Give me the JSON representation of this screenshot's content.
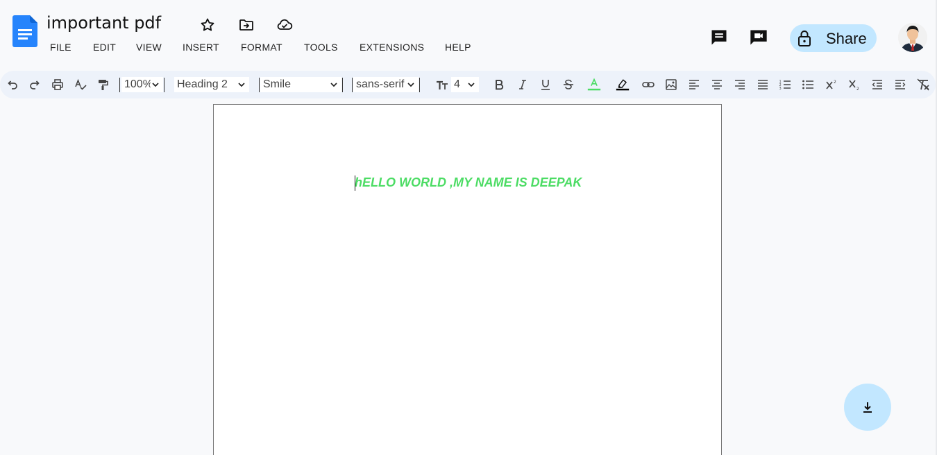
{
  "doc": {
    "title": "important pdf"
  },
  "menu": [
    {
      "label": "FILE"
    },
    {
      "label": "EDIT"
    },
    {
      "label": "VIEW"
    },
    {
      "label": "INSERT"
    },
    {
      "label": "FORMAT"
    },
    {
      "label": "TOOLS"
    },
    {
      "label": "EXTENSIONS"
    },
    {
      "label": "HELP"
    }
  ],
  "header": {
    "share_label": "Share",
    "icons": [
      "star-icon",
      "move-to-folder-icon",
      "cloud-saved-icon",
      "comment-history-icon",
      "meet-present-icon",
      "lock-icon"
    ]
  },
  "toolbar": {
    "zoom": "100%",
    "style": "Heading 2",
    "font": "Smile",
    "font_family": "sans-serif",
    "font_size": "4",
    "text_color": "#4cdc64",
    "highlight_color": "#000000"
  },
  "page": {
    "body_text": "hELLO WORLD ,MY NAME IS DEEPAK"
  },
  "colors": {
    "accent": "#c2e7ff",
    "doc_blue": "#2684fc",
    "text_green": "#4cdc64",
    "toolbar_bg": "#edf2fa"
  }
}
